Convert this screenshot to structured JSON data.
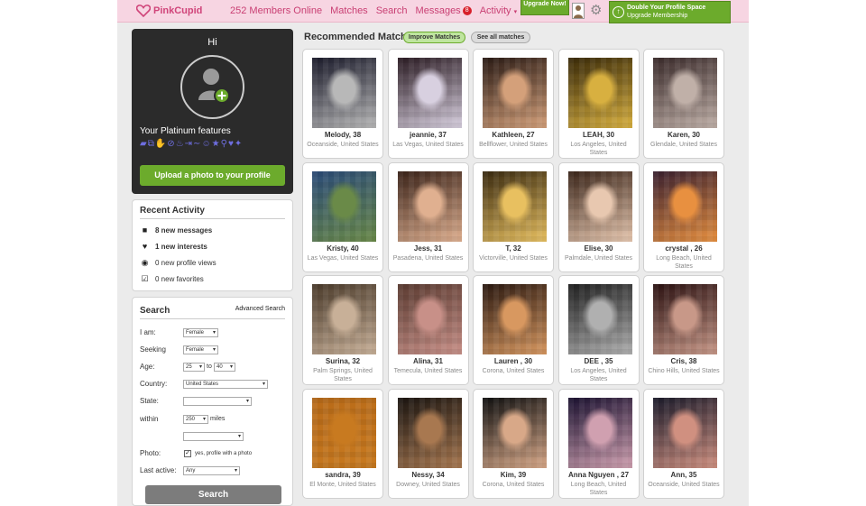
{
  "topbar": {
    "logo": "PinkCupid",
    "members_online": "252 Members Online",
    "nav": [
      "Matches",
      "Search",
      "Messages",
      "Activity"
    ],
    "messages_badge": "8",
    "activity_badge": "1",
    "upgrade_now": "Upgrade Now!",
    "double_line1": "Double Your Profile Space",
    "double_line2": "Upgrade Membership"
  },
  "profile": {
    "greeting": "Hi",
    "platinum_title": "Your Platinum features",
    "upload_label": "Upload a photo to your profile"
  },
  "recent": {
    "title": "Recent Activity",
    "items": [
      "8 new messages",
      "1 new interests",
      "0 new profile views",
      "0 new favorites"
    ]
  },
  "search": {
    "title": "Search",
    "advanced": "Advanced Search",
    "i_am_label": "I am:",
    "i_am": "Female",
    "seeking_label": "Seeking",
    "seeking": "Female",
    "age_label": "Age:",
    "age_from": "25",
    "age_to_word": "to",
    "age_to": "40",
    "country_label": "Country:",
    "country": "United States",
    "state_label": "State:",
    "state": "",
    "within_label": "within",
    "within": "250",
    "miles": "miles",
    "distance_extra": "",
    "photo_label": "Photo:",
    "photo_text": "yes, profile with a photo",
    "last_active_label": "Last active:",
    "last_active": "Any",
    "button": "Search"
  },
  "matches": {
    "title": "Recommended Matches",
    "improve": "Improve Matches",
    "see_all": "See all matches",
    "cards": [
      {
        "name": "Melody, 38",
        "loc": "Oceanside, United States",
        "c1": "#1a1a2a",
        "c2": "#b8b8b8"
      },
      {
        "name": "jeannie, 37",
        "loc": "Las Vegas, United States",
        "c1": "#2a1a22",
        "c2": "#d8d0e0"
      },
      {
        "name": "Kathleen, 27",
        "loc": "Bellflower, United States",
        "c1": "#2a1a14",
        "c2": "#d4a07a"
      },
      {
        "name": "LEAH, 30",
        "loc": "Los Angeles, United States",
        "c1": "#3a2a08",
        "c2": "#d8b040"
      },
      {
        "name": "Karen, 30",
        "loc": "Glendale, United States",
        "c1": "#3a2a2a",
        "c2": "#c0b0a8"
      },
      {
        "name": "Kristy, 40",
        "loc": "Las Vegas, United States",
        "c1": "#2a4a78",
        "c2": "#6a8a48"
      },
      {
        "name": "Jess, 31",
        "loc": "Pasadena, United States",
        "c1": "#3a2218",
        "c2": "#e0b090"
      },
      {
        "name": "T, 32",
        "loc": "Victorville, United States",
        "c1": "#3a2a10",
        "c2": "#e8c060"
      },
      {
        "name": "Elise, 30",
        "loc": "Palmdale, United States",
        "c1": "#3a2418",
        "c2": "#e8c8b0"
      },
      {
        "name": "crystal , 26",
        "loc": "Long Beach, United States",
        "c1": "#3a2030",
        "c2": "#e89040"
      },
      {
        "name": "Surina, 32",
        "loc": "Palm Springs, United States",
        "c1": "#4a3a2a",
        "c2": "#c8b098"
      },
      {
        "name": "Alina, 31",
        "loc": "Temecula, United States",
        "c1": "#5a3a30",
        "c2": "#c89088"
      },
      {
        "name": "Lauren , 30",
        "loc": "Corona, United States",
        "c1": "#2a1810",
        "c2": "#d89860"
      },
      {
        "name": "DEE , 35",
        "loc": "Los Angeles, United States",
        "c1": "#1e1e1e",
        "c2": "#b0b0b0"
      },
      {
        "name": "Cris, 38",
        "loc": "Chino Hills, United States",
        "c1": "#2a1010",
        "c2": "#c89888"
      },
      {
        "name": "sandra, 39",
        "loc": "El Monte, United States",
        "c1": "#b86a18",
        "c2": "#c87a20"
      },
      {
        "name": "Nessy, 34",
        "loc": "Downey, United States",
        "c1": "#1a1410",
        "c2": "#a87850"
      },
      {
        "name": "Kim, 39",
        "loc": "Corona, United States",
        "c1": "#101010",
        "c2": "#d8a888"
      },
      {
        "name": "Anna Nguyen , 27",
        "loc": "Long Beach, United States",
        "c1": "#1a1030",
        "c2": "#d0a0b0"
      },
      {
        "name": "Ann, 35",
        "loc": "Oceanside, United States",
        "c1": "#1a1a2a",
        "c2": "#d09080"
      }
    ]
  }
}
